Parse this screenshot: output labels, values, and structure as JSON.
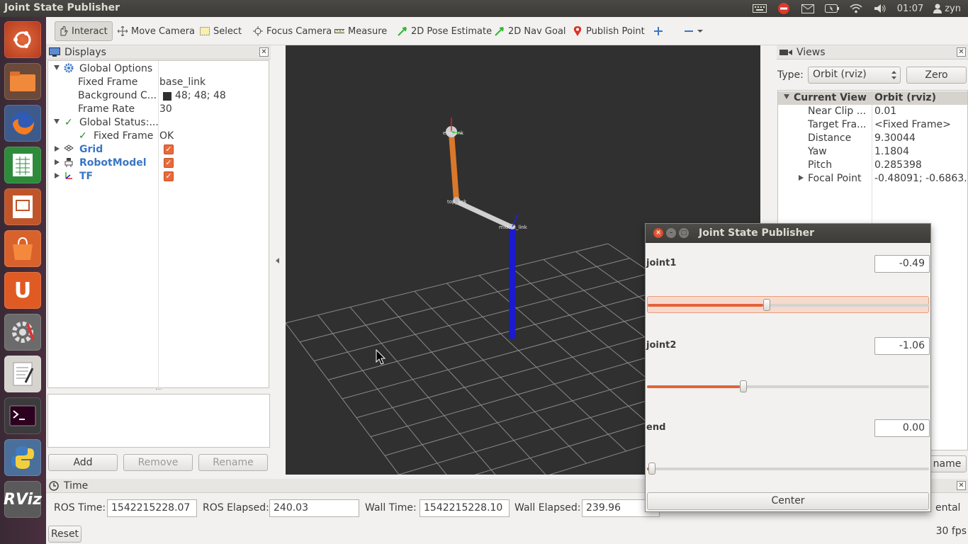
{
  "window": {
    "title": "Joint State Publisher"
  },
  "tray": {
    "clock": "01:07",
    "user": "zyn"
  },
  "launcher": [
    "ubuntu-dash",
    "files",
    "firefox",
    "libreoffice-calc",
    "libreoffice-impress",
    "software-center",
    "ubuntu-one",
    "system-settings",
    "text-editor",
    "terminal",
    "python",
    "rviz"
  ],
  "toolbar": {
    "interact": "Interact",
    "move_camera": "Move Camera",
    "select": "Select",
    "focus_camera": "Focus Camera",
    "measure": "Measure",
    "pose_estimate": "2D Pose Estimate",
    "nav_goal": "2D Nav Goal",
    "publish_point": "Publish Point"
  },
  "displays": {
    "title": "Displays",
    "global_options": "Global Options",
    "fixed_frame_label": "Fixed Frame",
    "fixed_frame_value": "base_link",
    "bg_label": "Background C...",
    "bg_value": "48; 48; 48",
    "frame_rate_label": "Frame Rate",
    "frame_rate_value": "30",
    "global_status": "Global Status:...",
    "status_fixed_frame": "Fixed Frame",
    "status_fixed_frame_value": "OK",
    "grid": "Grid",
    "robot_model": "RobotModel",
    "tf": "TF",
    "add": "Add",
    "remove": "Remove",
    "rename": "Rename"
  },
  "viewport": {
    "background": "#303030",
    "link_labels": [
      "end_link",
      "top_link",
      "middle_link"
    ]
  },
  "views": {
    "title": "Views",
    "type_label": "Type:",
    "type_value": "Orbit (rviz)",
    "zero": "Zero",
    "current_view": "Current View",
    "current_view_value": "Orbit (rviz)",
    "near_clip_label": "Near Clip ...",
    "near_clip_value": "0.01",
    "target_frame_label": "Target Fra...",
    "target_frame_value": "<Fixed Frame>",
    "distance_label": "Distance",
    "distance_value": "9.30044",
    "yaw_label": "Yaw",
    "yaw_value": "1.1804",
    "pitch_label": "Pitch",
    "pitch_value": "0.285398",
    "focal_point_label": "Focal Point",
    "focal_point_value": "-0.48091; -0.6863...",
    "rename_partial": "name"
  },
  "time": {
    "title": "Time",
    "ros_time_label": "ROS Time:",
    "ros_time_value": "1542215228.07",
    "ros_elapsed_label": "ROS Elapsed:",
    "ros_elapsed_value": "240.03",
    "wall_time_label": "Wall Time:",
    "wall_time_value": "1542215228.10",
    "wall_elapsed_label": "Wall Elapsed:",
    "wall_elapsed_value": "239.96",
    "experimental_partial": "ental"
  },
  "status": {
    "reset": "Reset",
    "fps": "30 fps"
  },
  "jsp": {
    "title": "Joint State Publisher",
    "joints": [
      {
        "name": "joint1",
        "value": "-0.49",
        "fraction": 0.42
      },
      {
        "name": "joint2",
        "value": "-1.06",
        "fraction": 0.335
      },
      {
        "name": "end",
        "value": "0.00",
        "fraction": 0.0
      }
    ],
    "center": "Center"
  },
  "colors": {
    "accent": "#e4633a",
    "link_orange": "#d9782a",
    "link_blue": "#1a1ad0",
    "checkbox": "#e96a3b"
  }
}
